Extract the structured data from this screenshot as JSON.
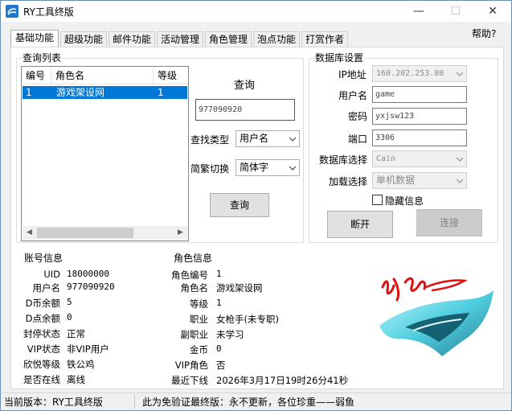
{
  "window": {
    "title": "RY工具终版",
    "controls": {
      "minimize": "—",
      "maximize": "☐",
      "close": "✕"
    }
  },
  "tabs": [
    {
      "label": "基础功能",
      "active": true
    },
    {
      "label": "超级功能",
      "active": false
    },
    {
      "label": "邮件功能",
      "active": false
    },
    {
      "label": "活动管理",
      "active": false
    },
    {
      "label": "角色管理",
      "active": false
    },
    {
      "label": "泡点功能",
      "active": false
    },
    {
      "label": "打赏作者",
      "active": false
    }
  ],
  "help_label": "帮助?",
  "query_list": {
    "title": "查询列表",
    "columns": [
      "编号",
      "角色名",
      "等级"
    ],
    "rows": [
      {
        "id": "1",
        "name": "游戏架设网",
        "level": "1"
      }
    ]
  },
  "query": {
    "title": "查询",
    "input_value": "977090920",
    "search_type_label": "查找类型",
    "search_type_value": "用户名",
    "convert_label": "简繁切换",
    "convert_value": "简体字",
    "button_label": "查询"
  },
  "db": {
    "title": "数据库设置",
    "ip_label": "IP地址",
    "ip_value": "160.202.253.80",
    "user_label": "用户名",
    "user_value": "game",
    "password_label": "密码",
    "password_value": "yxjsw123",
    "port_label": "端口",
    "port_value": "3306",
    "select_label": "数据库选择",
    "select_value": "Cain",
    "load_label": "加载选择",
    "load_value": "单机数据",
    "hide_label": "隐藏信息",
    "disconnect_label": "断开",
    "connect_label": "连接"
  },
  "account": {
    "title": "账号信息",
    "fields": [
      {
        "label": "UID",
        "value": "18000000"
      },
      {
        "label": "用户名",
        "value": "977090920"
      },
      {
        "label": "D币余额",
        "value": "5"
      },
      {
        "label": "D点余额",
        "value": "0"
      },
      {
        "label": "封停状态",
        "value": "正常"
      },
      {
        "label": "VIP状态",
        "value": "非VIP用户"
      },
      {
        "label": "欣悦等级",
        "value": "铁公鸡"
      },
      {
        "label": "是否在线",
        "value": "离线"
      }
    ]
  },
  "role": {
    "title": "角色信息",
    "fields": [
      {
        "label": "角色编号",
        "value": "1"
      },
      {
        "label": "角色名",
        "value": "游戏架设网"
      },
      {
        "label": "等级",
        "value": "1"
      },
      {
        "label": "职业",
        "value": "女枪手(未专职)"
      },
      {
        "label": "副职业",
        "value": "未学习"
      },
      {
        "label": "金币",
        "value": "0"
      },
      {
        "label": "VIP角色",
        "value": "否"
      },
      {
        "label": "最近下线",
        "value": "2026年3月17日19时26分41秒"
      }
    ]
  },
  "status": {
    "version": "当前版本：RY工具终版",
    "notice": "此为免验证最终版：永不更新，各位珍重——弱鱼"
  },
  "colors": {
    "selection": "#0078d7",
    "logo_cyan": "#6fe0f0",
    "logo_teal": "#1fb5c8",
    "signature_red": "#e01010"
  }
}
